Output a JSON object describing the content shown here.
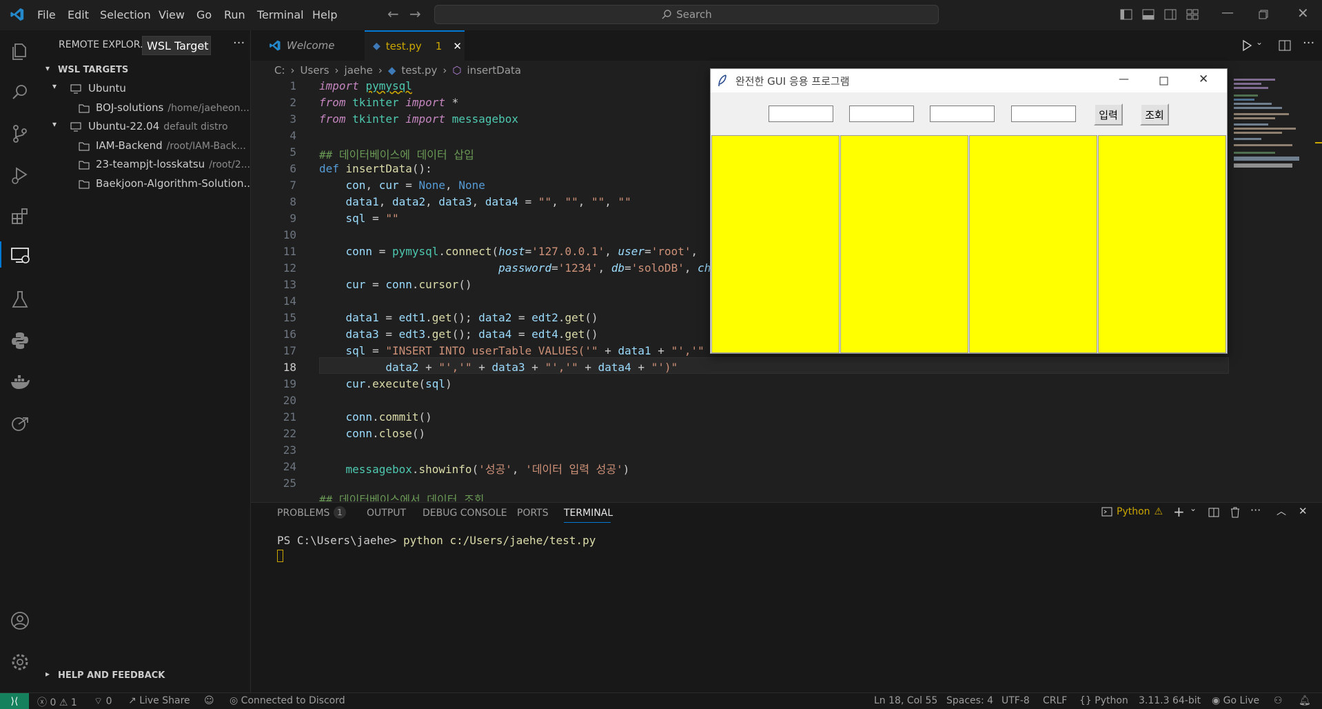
{
  "menu": {
    "items": [
      "File",
      "Edit",
      "Selection",
      "View",
      "Go",
      "Run",
      "Terminal",
      "Help"
    ],
    "search_placeholder": "Search"
  },
  "sidebar": {
    "header": "REMOTE EXPLOR...",
    "dropdown": "WSL Target",
    "section": "WSL TARGETS",
    "items": [
      {
        "label": "Ubuntu",
        "desc": ""
      },
      {
        "label": "BOJ-solutions",
        "desc": "/home/jaeheon..."
      },
      {
        "label": "Ubuntu-22.04",
        "desc": "default distro"
      },
      {
        "label": "IAM-Backend",
        "desc": "/root/IAM-Back..."
      },
      {
        "label": "23-teampjt-losskatsu",
        "desc": "/root/2..."
      },
      {
        "label": "Baekjoon-Algorithm-Solution...",
        "desc": ""
      }
    ],
    "help": "HELP AND FEEDBACK"
  },
  "tabs": [
    {
      "label": "Welcome"
    },
    {
      "label": "test.py",
      "badge": "1"
    }
  ],
  "breadcrumb": [
    "C:",
    "Users",
    "jaehe",
    "test.py",
    "insertData"
  ],
  "tk": {
    "title": "완전한 GUI 응용 프로그램",
    "btn_insert": "입력",
    "btn_query": "조회",
    "list_color": "#ffff00"
  },
  "panel": {
    "tabs": [
      "PROBLEMS",
      "OUTPUT",
      "DEBUG CONSOLE",
      "PORTS",
      "TERMINAL"
    ],
    "problems_count": "1",
    "terminal_profile": "Python",
    "prompt": "PS C:\\Users\\jaehe> ",
    "command": "python c:/Users/jaehe/test.py"
  },
  "status": {
    "errors": "0",
    "warnings": "1",
    "ports": "0",
    "live_share": "Live Share",
    "discord": "Connected to Discord",
    "position": "Ln 18, Col 55",
    "spaces": "Spaces: 4",
    "encoding": "UTF-8",
    "eol": "CRLF",
    "language": "Python",
    "interpreter": "3.11.3 64-bit",
    "go_live": "Go Live"
  },
  "colors": {
    "accent": "#0078d4",
    "remote": "#16825d",
    "warning": "#cca700"
  }
}
